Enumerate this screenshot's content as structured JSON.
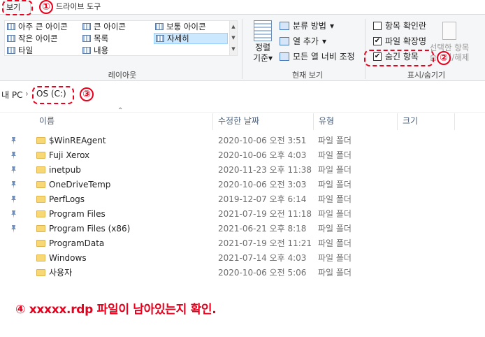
{
  "ribbon_tabs": {
    "view": "보기",
    "drive_tools": "드라이브 도구"
  },
  "layout_group": {
    "label": "레이아웃",
    "items": [
      "아주 큰 아이콘",
      "큰 아이콘",
      "보통 아이콘",
      "작은 아이콘",
      "목록",
      "자세히",
      "타일",
      "내용"
    ],
    "selected": "자세히"
  },
  "current_view": {
    "label": "현재 보기",
    "sort_line1": "정렬",
    "sort_line2": "기준",
    "group_by": "분류 방법",
    "add_columns": "열 추가",
    "size_all_columns": "모든 열 너비 조정"
  },
  "show_hide": {
    "label": "표시/숨기기",
    "item_checkboxes": {
      "label": "항목 확인란",
      "checked": false
    },
    "file_extensions": {
      "label": "파일 확장명",
      "checked": true
    },
    "hidden_items": {
      "label": "숨긴 항목",
      "checked": true
    },
    "hide_selected_line1": "선택한 항목",
    "hide_selected_line2": "숨기기/해제"
  },
  "address": {
    "root": "내 PC",
    "separator": "›",
    "current": "OS (C:)"
  },
  "columns": {
    "name": "이름",
    "modified": "수정한 날짜",
    "type": "유형",
    "size": "크기"
  },
  "files": [
    {
      "name": "$WinREAgent",
      "modified": "2020-10-06 오전 3:51",
      "type": "파일 폴더",
      "pinned": true
    },
    {
      "name": "Fuji Xerox",
      "modified": "2020-10-06 오후 4:03",
      "type": "파일 폴더",
      "pinned": true
    },
    {
      "name": "inetpub",
      "modified": "2020-11-23 오후 11:38",
      "type": "파일 폴더",
      "pinned": true
    },
    {
      "name": "OneDriveTemp",
      "modified": "2020-10-06 오전 3:03",
      "type": "파일 폴더",
      "pinned": true
    },
    {
      "name": "PerfLogs",
      "modified": "2019-12-07 오후 6:14",
      "type": "파일 폴더",
      "pinned": true
    },
    {
      "name": "Program Files",
      "modified": "2021-07-19 오전 11:18",
      "type": "파일 폴더",
      "pinned": true
    },
    {
      "name": "Program Files (x86)",
      "modified": "2021-06-21 오후 8:18",
      "type": "파일 폴더",
      "pinned": true
    },
    {
      "name": "ProgramData",
      "modified": "2021-07-19 오전 11:21",
      "type": "파일 폴더",
      "pinned": false
    },
    {
      "name": "Windows",
      "modified": "2021-07-14 오후 4:03",
      "type": "파일 폴더",
      "pinned": false
    },
    {
      "name": "사용자",
      "modified": "2020-10-06 오전 5:06",
      "type": "파일 폴더",
      "pinned": false
    }
  ],
  "annotations": {
    "step1": "①",
    "step2": "②",
    "step3": "③",
    "note": "④  xxxxx.rdp 파일이 남아있는지 확인.",
    "color": "#e8001c"
  },
  "icons": {
    "folder": "folder-icon",
    "pin": "pin-icon",
    "check": "✔",
    "sort_arrow": "⌃",
    "dropdown": "▾"
  }
}
